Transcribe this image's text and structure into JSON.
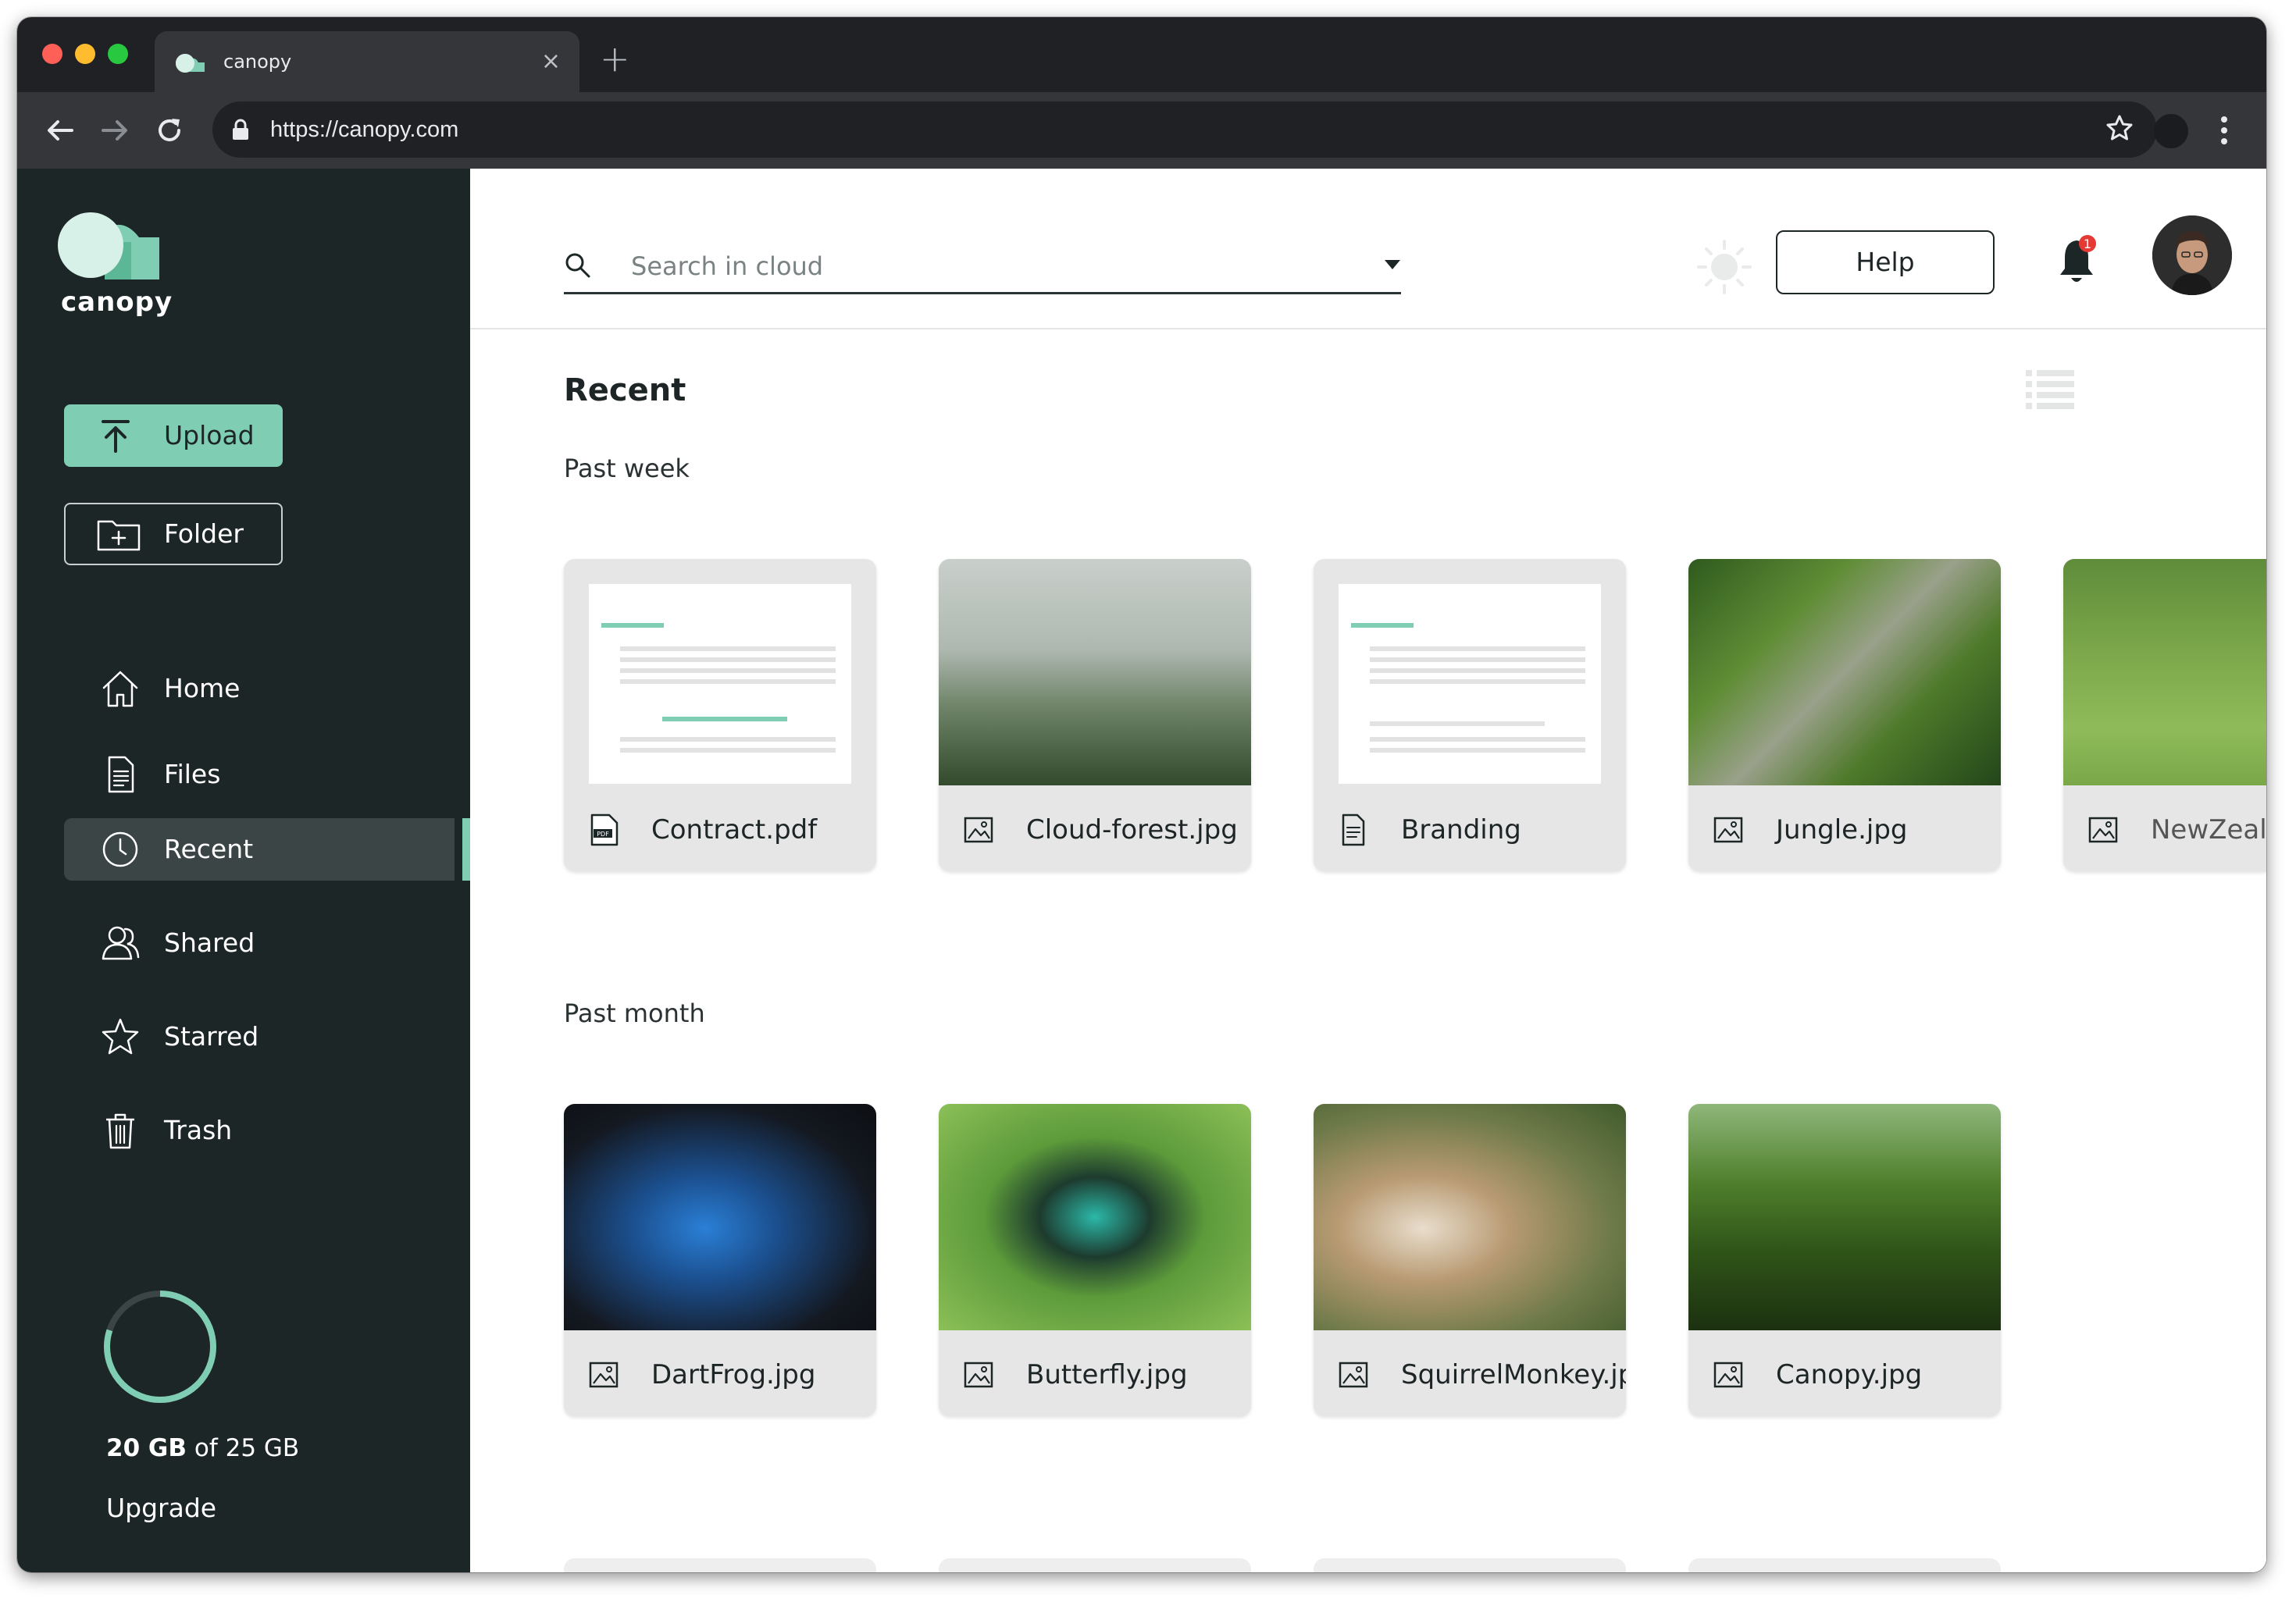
{
  "browser": {
    "tab_title": "canopy",
    "url": "https://canopy.com",
    "new_tab_label": "+",
    "close_tab_label": "×"
  },
  "sidebar": {
    "brand": "canopy",
    "upload_label": "Upload",
    "folder_label": "Folder",
    "nav": [
      {
        "label": "Home",
        "icon": "home-icon"
      },
      {
        "label": "Files",
        "icon": "file-icon"
      },
      {
        "label": "Recent",
        "icon": "clock-icon",
        "active": true
      },
      {
        "label": "Shared",
        "icon": "shared-users-icon"
      },
      {
        "label": "Starred",
        "icon": "star-icon"
      },
      {
        "label": "Trash",
        "icon": "trash-icon"
      }
    ],
    "storage": {
      "used": "20 GB",
      "of_text": " of 25 GB",
      "used_fraction": 0.8
    },
    "upgrade_label": "Upgrade"
  },
  "header": {
    "search_placeholder": "Search in cloud",
    "help_label": "Help",
    "notification_count": "1"
  },
  "main": {
    "title": "Recent",
    "groups": [
      {
        "label": "Past week",
        "items": [
          {
            "name": "Contract.pdf",
            "kind": "pdf"
          },
          {
            "name": "Cloud-forest.jpg",
            "kind": "image"
          },
          {
            "name": "Branding",
            "kind": "doc"
          },
          {
            "name": "Jungle.jpg",
            "kind": "image"
          },
          {
            "name": "NewZeala",
            "kind": "image"
          }
        ]
      },
      {
        "label": "Past month",
        "items": [
          {
            "name": "DartFrog.jpg",
            "kind": "image"
          },
          {
            "name": "Butterfly.jpg",
            "kind": "image"
          },
          {
            "name": "SquirrelMonkey.jp",
            "kind": "image"
          },
          {
            "name": "Canopy.jpg",
            "kind": "image"
          }
        ]
      }
    ]
  },
  "colors": {
    "sidebar_bg": "#1d2627",
    "accent": "#7fcdb2",
    "active_item_bg": "#3b4546",
    "badge": "#e53935"
  }
}
